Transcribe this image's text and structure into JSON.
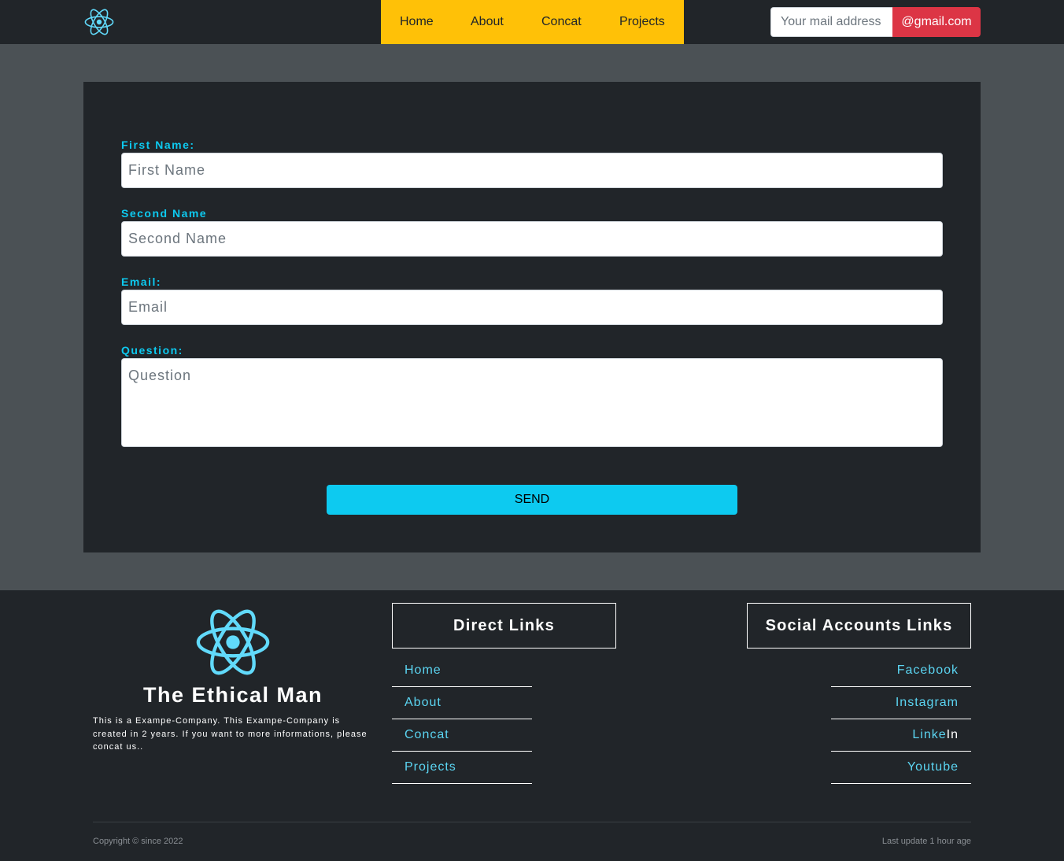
{
  "navbar": {
    "logo_icon": "react-atom-icon",
    "menu": [
      "Home",
      "About",
      "Concat",
      "Projects"
    ],
    "mail_placeholder": "Your mail address",
    "mail_suffix": "@gmail.com",
    "menu_bg": "#ffc107",
    "suffix_bg": "#dc3545"
  },
  "form": {
    "first_name_label": "First Name:",
    "first_name_placeholder": "First Name",
    "second_name_label": "Second Name",
    "second_name_placeholder": "Second Name",
    "email_label": "Email:",
    "email_placeholder": "Email",
    "question_label": "Question:",
    "question_placeholder": "Question",
    "send_label": "SEND",
    "accent": "#0dcaf0"
  },
  "footer": {
    "logo_icon": "react-atom-icon",
    "brand": "The Ethical Man",
    "description": "This is a Exampe-Company. This Exampe-Company is created in 2 years. If you want to more informations, please concat us..",
    "direct_links_title": "Direct Links",
    "direct_links": [
      "Home",
      "About",
      "Concat",
      "Projects"
    ],
    "social_title": "Social Accounts Links",
    "social_links": {
      "facebook": "Facebook",
      "instagram": "Instagram",
      "linkedin_a": "Linke",
      "linkedin_b": "In",
      "youtube": "Youtube"
    },
    "copyright": "Copyright © since 2022",
    "last_update": "Last update 1 hour age"
  }
}
